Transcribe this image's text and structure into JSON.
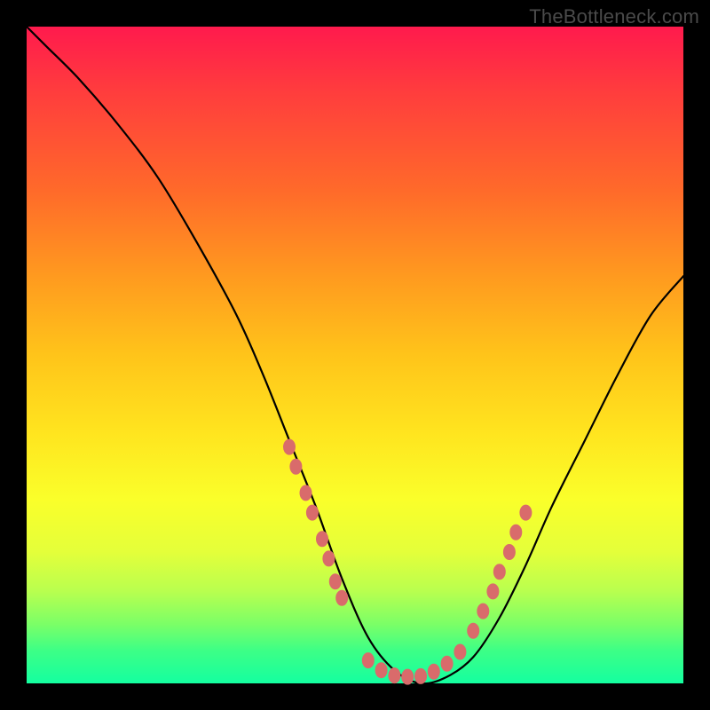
{
  "watermark": "TheBottleneck.com",
  "chart_data": {
    "type": "line",
    "title": "",
    "xlabel": "",
    "ylabel": "",
    "xlim": [
      0,
      100
    ],
    "ylim": [
      0,
      100
    ],
    "series": [
      {
        "name": "bottleneck-curve",
        "x": [
          0,
          3,
          8,
          14,
          20,
          26,
          32,
          36,
          40,
          44,
          48,
          52,
          56,
          60,
          64,
          68,
          72,
          76,
          80,
          85,
          90,
          95,
          100
        ],
        "y": [
          100,
          97,
          92,
          85,
          77,
          67,
          56,
          47,
          37,
          27,
          16,
          7,
          2,
          0,
          1,
          4,
          10,
          18,
          27,
          37,
          47,
          56,
          62
        ]
      }
    ],
    "highlight_points": {
      "left_arm": [
        [
          40,
          36
        ],
        [
          41,
          33
        ],
        [
          42.5,
          29
        ],
        [
          43.5,
          26
        ],
        [
          45,
          22
        ],
        [
          46,
          19
        ],
        [
          47,
          15.5
        ],
        [
          48,
          13
        ]
      ],
      "valley": [
        [
          52,
          3.5
        ],
        [
          54,
          2
        ],
        [
          56,
          1.2
        ],
        [
          58,
          1
        ],
        [
          60,
          1.1
        ],
        [
          62,
          1.8
        ],
        [
          64,
          3
        ],
        [
          66,
          4.8
        ]
      ],
      "right_arm": [
        [
          68,
          8
        ],
        [
          69.5,
          11
        ],
        [
          71,
          14
        ],
        [
          72,
          17
        ],
        [
          73.5,
          20
        ],
        [
          74.5,
          23
        ],
        [
          76,
          26
        ]
      ]
    },
    "gradient_stops": [
      {
        "pos": 0,
        "color": "#ff1a4d"
      },
      {
        "pos": 50,
        "color": "#ffc41a"
      },
      {
        "pos": 100,
        "color": "#14ffa0"
      }
    ]
  }
}
